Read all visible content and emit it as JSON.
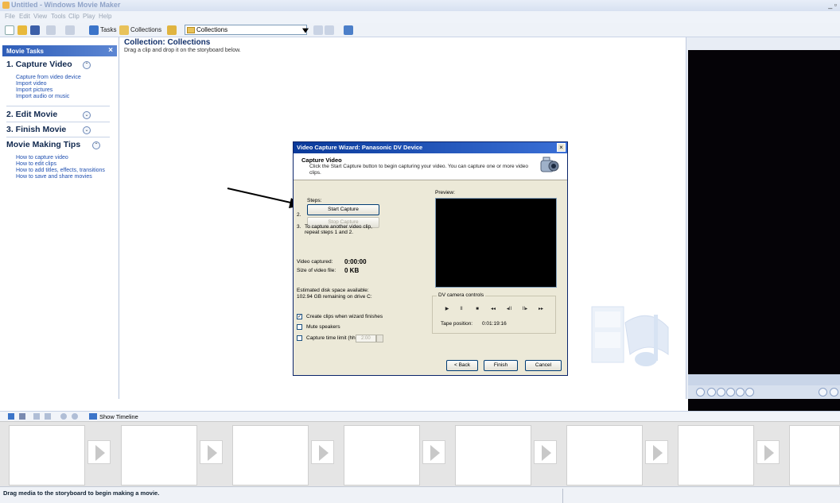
{
  "window": {
    "title": "Untitled - Windows Movie Maker",
    "controls": "_ ▫"
  },
  "menu": [
    "File",
    "Edit",
    "View",
    "Tools",
    "Clip",
    "Play",
    "Help"
  ],
  "toolbar": {
    "tasks_label": "Tasks",
    "collections_label": "Collections",
    "collection_select_value": "Collections"
  },
  "task_pane": {
    "header": "Movie Tasks",
    "close": "×",
    "sections": [
      {
        "title": "1. Capture Video",
        "links": [
          "Capture from video device",
          "Import video",
          "Import pictures",
          "Import audio or music"
        ]
      },
      {
        "title": "2. Edit Movie",
        "links": []
      },
      {
        "title": "3. Finish Movie",
        "links": []
      },
      {
        "title": "Movie Making Tips",
        "links": [
          "How to capture video",
          "How to edit clips",
          "How to add titles, effects, transitions",
          "How to save and share movies"
        ]
      }
    ]
  },
  "collection": {
    "title": "Collection: Collections",
    "subtitle": "Drag a clip and drop it on the storyboard below."
  },
  "wizard": {
    "title": "Video Capture Wizard: Panasonic DV Device",
    "close": "×",
    "heading": "Capture Video",
    "description": "Click the Start Capture button to begin capturing your video. You can capture one or more video clips.",
    "steps_label": "Steps:",
    "start_capture": "Start Capture",
    "step2_num": "2.",
    "stop_capture": "Stop Capture",
    "step3_num": "3.",
    "step3_text": "To capture another video clip, repeat steps 1 and 2.",
    "video_captured_label": "Video captured:",
    "video_captured_value": "0:00:00",
    "size_label": "Size of video file:",
    "size_value": "0 KB",
    "disk_label": "Estimated disk space available:",
    "disk_value": "102.94 GB remaining on drive C:",
    "opt_create_clips": "Create clips when wizard finishes",
    "opt_create_clips_checked": true,
    "opt_mute": "Mute speakers",
    "opt_mute_checked": false,
    "opt_time_limit": "Capture time limit (hh:mm):",
    "opt_time_limit_checked": false,
    "time_limit_value": "2:00",
    "preview_label": "Preview:",
    "dv_controls_label": "DV camera controls",
    "dv_buttons": [
      "▶",
      "II",
      "■",
      "◂◂",
      "◂II",
      "II▸",
      "▸▸"
    ],
    "tape_position_label": "Tape position:",
    "tape_position_value": "0:01:19:16",
    "back": "< Back",
    "finish": "Finish",
    "cancel": "Cancel"
  },
  "storyboard_toolbar": {
    "show_timeline": "Show Timeline"
  },
  "status": {
    "text": "Drag media to the storyboard to begin making a movie."
  }
}
